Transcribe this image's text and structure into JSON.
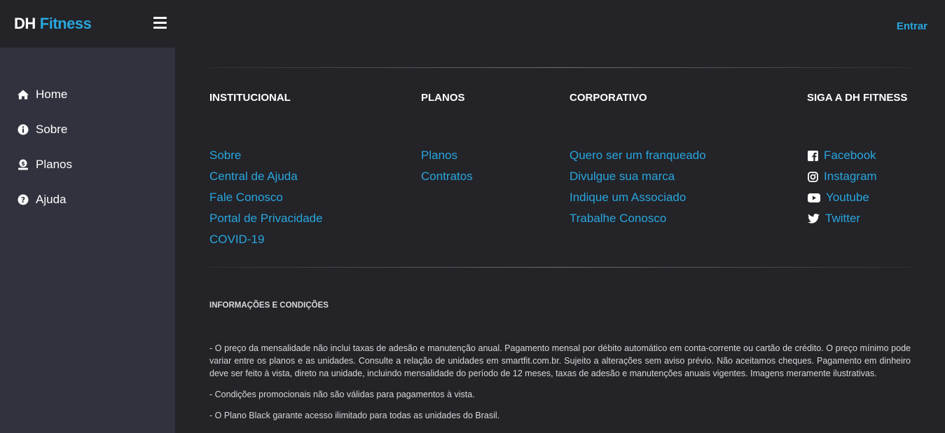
{
  "brand": {
    "part1": "DH",
    "part2": "Fitness"
  },
  "header": {
    "login_label": "Entrar"
  },
  "sidebar": {
    "items": [
      {
        "label": "Home",
        "icon": "home-icon"
      },
      {
        "label": "Sobre",
        "icon": "info-icon"
      },
      {
        "label": "Planos",
        "icon": "plans-icon"
      },
      {
        "label": "Ajuda",
        "icon": "help-icon"
      }
    ]
  },
  "footer": {
    "institucional": {
      "title": "INSTITUCIONAL",
      "links": [
        "Sobre",
        "Central de Ajuda",
        "Fale Conosco",
        "Portal de Privacidade",
        "COVID-19"
      ]
    },
    "planos": {
      "title": "PLANOS",
      "links": [
        "Planos",
        "Contratos"
      ]
    },
    "corporativo": {
      "title": "CORPORATIVO",
      "links": [
        "Quero ser um franqueado",
        "Divulgue sua marca",
        "Indique um Associado",
        "Trabalhe Conosco"
      ]
    },
    "social": {
      "title": "SIGA A DH FITNESS",
      "links": [
        {
          "label": "Facebook",
          "icon": "facebook-icon"
        },
        {
          "label": "Instagram",
          "icon": "instagram-icon"
        },
        {
          "label": "Youtube",
          "icon": "youtube-icon"
        },
        {
          "label": "Twitter",
          "icon": "twitter-icon"
        }
      ]
    }
  },
  "info": {
    "title": "INFORMAÇÕES E CONDIÇÕES",
    "paragraphs": [
      "- O preço da mensalidade não inclui taxas de adesão e manutenção anual. Pagamento mensal por débito automático em conta-corrente ou cartão de crédito. O preço mínimo pode variar entre os planos e as unidades. Consulte a relação de unidades em smartfit.com.br. Sujeito a alterações sem aviso prévio. Não aceitamos cheques. Pagamento em dinheiro deve ser feito à vista, direto na unidade, incluindo mensalidade do período de 12 meses, taxas de adesão e manutenções anuais vigentes. Imagens meramente ilustrativas.",
      "- Condições promocionais não são válidas para pagamentos à vista.",
      "- O Plano Black garante acesso ilimitado para todas as unidades do Brasil."
    ]
  },
  "colors": {
    "accent": "#29a6dd",
    "sidebar_bg": "#30323d",
    "page_bg": "#232328"
  }
}
